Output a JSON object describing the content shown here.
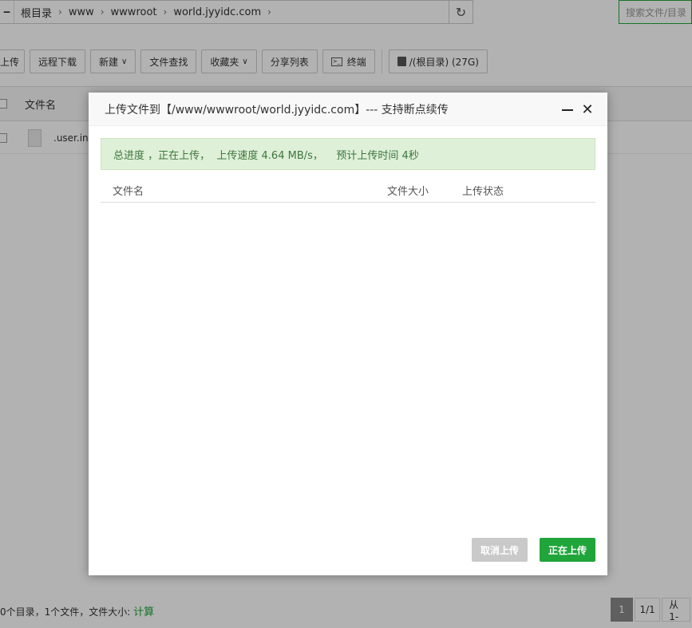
{
  "pathbar": {
    "back_glyph": "‒",
    "crumbs": [
      "根目录",
      "www",
      "wwwroot",
      "world.jyyidc.com"
    ],
    "sep_glyph": "›",
    "refresh_glyph": "↻"
  },
  "search": {
    "placeholder": "搜索文件/目录"
  },
  "toolbar": {
    "upload": "上传",
    "remote_download": "远程下载",
    "new": "新建",
    "file_search": "文件查找",
    "favorites": "收藏夹",
    "share_list": "分享列表",
    "terminal": "终端",
    "disk": "/(根目录) (27G)",
    "chev_glyph": "∨"
  },
  "table": {
    "col_name": "文件名",
    "rows": [
      {
        "name": ".user.ini"
      }
    ]
  },
  "footer": {
    "info": "0个目录，1个文件，文件大小: ",
    "calc_link": "计算",
    "pages": [
      "1",
      "1/1",
      "从1-"
    ]
  },
  "modal": {
    "title": "上传文件到【/www/wwwroot/world.jyyidc.com】--- 支持断点续传",
    "progress_text": "总进度 ，正在上传，  上传速度 4.64 MB/s，    预计上传时间 4秒",
    "columns": [
      "文件名",
      "文件大小",
      "上传状态"
    ],
    "close_glyph": "✕",
    "cancel_label": "取消上传",
    "upload_label": "正在上传"
  },
  "colors": {
    "accent": "#20a53a",
    "progress_bg": "#dff0d8",
    "progress_text": "#3c763d"
  }
}
